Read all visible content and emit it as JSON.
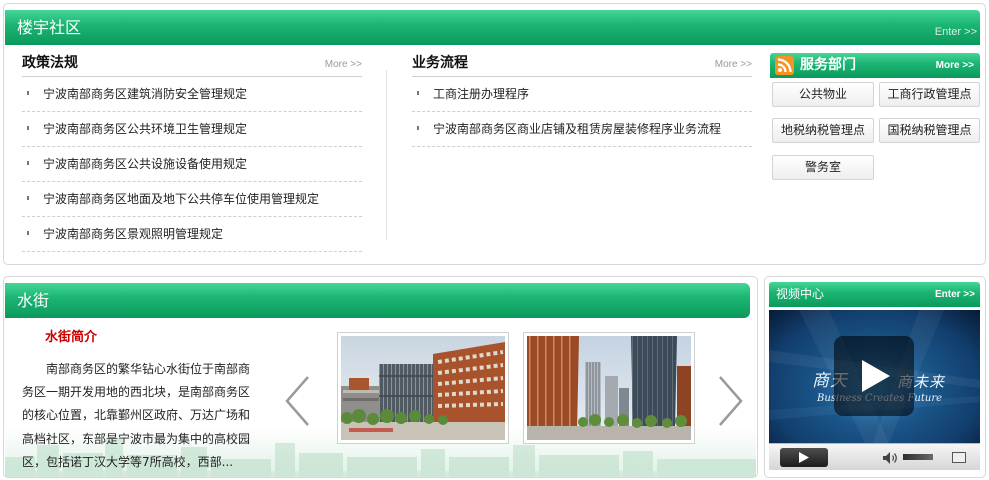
{
  "community": {
    "title": "楼宇社区",
    "enter_label": "Enter >>",
    "policies": {
      "title": "政策法规",
      "more_label": "More >>",
      "items": [
        "宁波南部商务区建筑消防安全管理规定",
        "宁波南部商务区公共环境卫生管理规定",
        "宁波南部商务区公共设施设备使用规定",
        "宁波南部商务区地面及地下公共停车位使用管理规定",
        "宁波南部商务区景观照明管理规定"
      ]
    },
    "business": {
      "title": "业务流程",
      "more_label": "More >>",
      "items": [
        "工商注册办理程序",
        "宁波南部商务区商业店铺及租赁房屋装修程序业务流程"
      ]
    },
    "services": {
      "title": "服务部门",
      "more_label": "More >>",
      "buttons": [
        "公共物业",
        "工商行政管理点",
        "地税纳税管理点",
        "国税纳税管理点",
        "警务室"
      ]
    }
  },
  "water_street": {
    "title": "水街",
    "intro_title": "水街简介",
    "intro_lines": [
      "南部商务区的繁华钻心水街位于南部商",
      "务区一期开发用地的西北块，是南部商务区",
      "的核心位置，北靠鄞州区政府、万达广场和",
      "高档社区，东部是宁波市最为集中的高校园",
      "区，包括诺丁汉大学等7所高校，西部..."
    ]
  },
  "video": {
    "title": "视频中心",
    "enter_label": "Enter >>",
    "slogan_left": "商天",
    "slogan_right": "商未来",
    "slogan_en": "Business Creates Future",
    "volume_level": 1.0
  },
  "colors": {
    "brand_green": "#12a866",
    "intro_title_red": "#cc0000",
    "rss_orange": "#f39423",
    "video_bg": "#123f6e"
  },
  "icons": {
    "rss": "rss-icon",
    "bullet": "bullet-icon",
    "previous": "chevron-left-icon",
    "next": "chevron-right-icon",
    "play": "play-icon",
    "volume": "volume-icon",
    "fullscreen": "fullscreen-icon"
  }
}
